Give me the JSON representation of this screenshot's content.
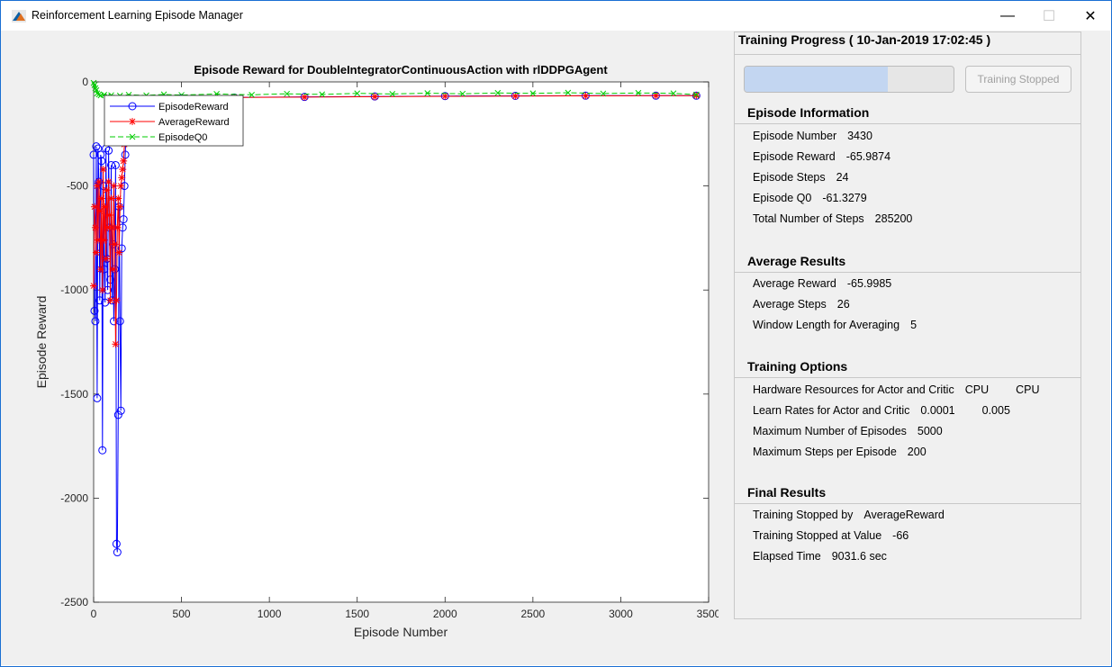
{
  "window": {
    "title": "Reinforcement Learning Episode Manager",
    "minimize_glyph": "—",
    "maximize_glyph": "☐",
    "close_glyph": "✕"
  },
  "chart_data": {
    "type": "line",
    "title": "Episode Reward for DoubleIntegratorContinuousAction with rlDDPGAgent",
    "xlabel": "Episode Number",
    "ylabel": "Episode Reward",
    "xlim": [
      0,
      3500
    ],
    "ylim": [
      -2500,
      0
    ],
    "xticks": [
      "0",
      "500",
      "1000",
      "1500",
      "2000",
      "2500",
      "3000",
      "3500"
    ],
    "yticks": [
      "0",
      "-500",
      "-1000",
      "-1500",
      "-2000",
      "-2500"
    ],
    "legend_placement": "top-left",
    "grid": false,
    "series": [
      {
        "name": "EpisodeReward",
        "color": "#0000ff",
        "marker": "circle",
        "line": "solid",
        "x": [
          0,
          5,
          10,
          15,
          20,
          25,
          30,
          35,
          40,
          45,
          50,
          55,
          60,
          65,
          70,
          75,
          80,
          85,
          90,
          95,
          100,
          105,
          110,
          115,
          120,
          125,
          130,
          135,
          140,
          145,
          150,
          155,
          160,
          165,
          170,
          175,
          180,
          190,
          200,
          250,
          300,
          400,
          500,
          800,
          1200,
          1600,
          2000,
          2400,
          2800,
          3200,
          3430
        ],
        "y": [
          -350,
          -1100,
          -1150,
          -310,
          -1520,
          -320,
          -480,
          -1050,
          -350,
          -380,
          -1770,
          -500,
          -900,
          -1060,
          -320,
          -850,
          -1000,
          -330,
          -700,
          -950,
          -400,
          -1050,
          -780,
          -1150,
          -900,
          -400,
          -2220,
          -2260,
          -1600,
          -600,
          -1150,
          -1580,
          -800,
          -700,
          -660,
          -500,
          -350,
          -120,
          -100,
          -90,
          -85,
          -80,
          -78,
          -75,
          -72,
          -70,
          -68,
          -67,
          -66,
          -66,
          -66
        ]
      },
      {
        "name": "AverageReward",
        "color": "#ff0000",
        "marker": "star",
        "line": "solid",
        "x": [
          0,
          5,
          10,
          15,
          20,
          25,
          30,
          35,
          40,
          45,
          50,
          55,
          60,
          65,
          70,
          75,
          80,
          85,
          90,
          95,
          100,
          105,
          110,
          115,
          120,
          125,
          130,
          135,
          140,
          145,
          150,
          155,
          160,
          165,
          170,
          175,
          180,
          190,
          200,
          250,
          300,
          400,
          500,
          800,
          1200,
          1600,
          2000,
          2400,
          2800,
          3200,
          3430
        ],
        "y": [
          -980,
          -600,
          -700,
          -820,
          -500,
          -760,
          -480,
          -620,
          -900,
          -560,
          -1000,
          -420,
          -760,
          -600,
          -850,
          -520,
          -700,
          -480,
          -640,
          -1050,
          -560,
          -700,
          -900,
          -500,
          -780,
          -1260,
          -1050,
          -700,
          -560,
          -820,
          -600,
          -500,
          -460,
          -420,
          -380,
          -300,
          -200,
          -110,
          -95,
          -88,
          -84,
          -80,
          -78,
          -75,
          -73,
          -71,
          -69,
          -68,
          -67,
          -66,
          -66
        ]
      },
      {
        "name": "EpisodeQ0",
        "color": "#00cc00",
        "marker": "x",
        "line": "dashed",
        "x": [
          0,
          5,
          10,
          15,
          20,
          30,
          40,
          60,
          80,
          100,
          150,
          200,
          300,
          400,
          500,
          700,
          900,
          1100,
          1300,
          1500,
          1700,
          1900,
          2100,
          2300,
          2500,
          2700,
          2900,
          3100,
          3300,
          3430
        ],
        "y": [
          -5,
          -15,
          -30,
          -40,
          -55,
          -60,
          -65,
          -62,
          -68,
          -64,
          -66,
          -62,
          -65,
          -60,
          -63,
          -58,
          -62,
          -57,
          -60,
          -55,
          -58,
          -54,
          -57,
          -53,
          -55,
          -52,
          -56,
          -53,
          -55,
          -61
        ]
      }
    ]
  },
  "side": {
    "header": "Training Progress ( 10-Jan-2019 17:02:45 )",
    "progress_fraction": 0.686,
    "stopped_button": "Training Stopped",
    "episode_info": {
      "heading": "Episode Information",
      "rows": [
        {
          "label": "Episode Number",
          "value": "3430"
        },
        {
          "label": "Episode Reward",
          "value": "-65.9874"
        },
        {
          "label": "Episode Steps",
          "value": "24"
        },
        {
          "label": "Episode Q0",
          "value": "-61.3279"
        },
        {
          "label": "Total Number of Steps",
          "value": "285200"
        }
      ]
    },
    "average_results": {
      "heading": "Average Results",
      "rows": [
        {
          "label": "Average Reward",
          "value": "-65.9985"
        },
        {
          "label": "Average Steps",
          "value": "26"
        },
        {
          "label": "Window Length for Averaging",
          "value": "5"
        }
      ]
    },
    "training_options": {
      "heading": "Training Options",
      "rows": [
        {
          "label": "Hardware Resources for Actor and Critic",
          "value": "CPU",
          "value2": "CPU"
        },
        {
          "label": "Learn Rates for Actor and Critic",
          "value": "0.0001",
          "value2": "0.005"
        },
        {
          "label": "Maximum Number of Episodes",
          "value": "5000"
        },
        {
          "label": "Maximum Steps per Episode",
          "value": "200"
        }
      ]
    },
    "final_results": {
      "heading": "Final Results",
      "rows": [
        {
          "label": "Training Stopped by",
          "value": "AverageReward"
        },
        {
          "label": "Training Stopped at Value",
          "value": "-66"
        },
        {
          "label": "Elapsed Time",
          "value": "9031.6 sec"
        }
      ]
    }
  }
}
